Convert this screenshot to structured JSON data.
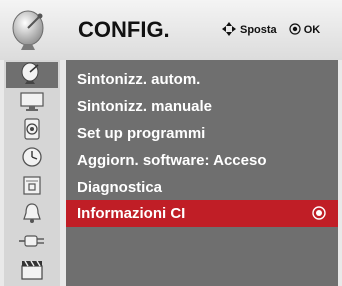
{
  "header": {
    "title": "CONFIG.",
    "hint_move": "Sposta",
    "hint_ok": "OK",
    "icon": "satellite-dish-icon"
  },
  "sidebar": {
    "items": [
      {
        "icon": "satellite-dish-icon",
        "active": true
      },
      {
        "icon": "tv-screen-icon",
        "active": false
      },
      {
        "icon": "speaker-icon",
        "active": false
      },
      {
        "icon": "clock-icon",
        "active": false
      },
      {
        "icon": "lock-icon",
        "active": false
      },
      {
        "icon": "bell-icon",
        "active": false
      },
      {
        "icon": "input-plug-icon",
        "active": false
      },
      {
        "icon": "clapperboard-icon",
        "active": false
      }
    ]
  },
  "menu": {
    "items": [
      {
        "label": "Sintonizz. autom."
      },
      {
        "label": "Sintonizz. manuale"
      },
      {
        "label": "Set up programmi"
      },
      {
        "label": "Aggiorn. software: Acceso"
      },
      {
        "label": "Diagnostica"
      },
      {
        "label": "Informazioni CI",
        "selected": true
      }
    ]
  },
  "colors": {
    "panel": "#6f6f6f",
    "selected": "#c01e26",
    "sidebar": "#d6d6d6"
  }
}
